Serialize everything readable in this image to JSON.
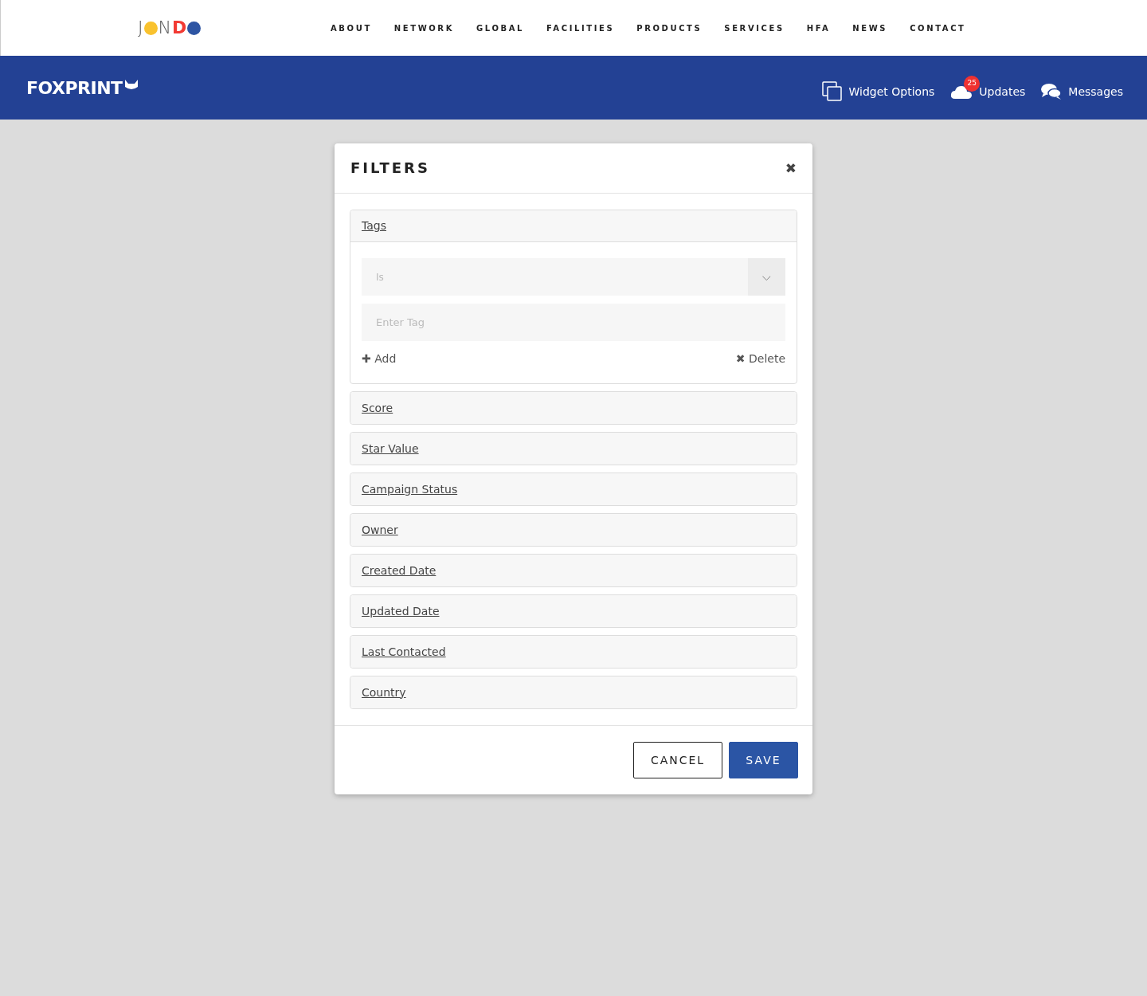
{
  "top_nav": {
    "logo": [
      {
        "kind": "letter",
        "text": "J"
      },
      {
        "kind": "dot",
        "color": "#f9c22e"
      },
      {
        "kind": "letter",
        "text": "N"
      },
      {
        "kind": "bold",
        "text": "D",
        "color": "#f23a33"
      },
      {
        "kind": "dot",
        "color": "#2e55a3"
      }
    ],
    "links": [
      "ABOUT",
      "NETWORK",
      "GLOBAL",
      "FACILITIES",
      "PRODUCTS",
      "SERVICES",
      "HFA",
      "NEWS",
      "CONTACT"
    ]
  },
  "app_bar": {
    "brand": "FOXPRINT",
    "actions": [
      {
        "kind": "widgets",
        "label": "Widget Options"
      },
      {
        "kind": "updates",
        "label": "Updates",
        "badge": "25"
      },
      {
        "kind": "messages",
        "label": "Messages"
      }
    ]
  },
  "modal": {
    "title": "FILTERS",
    "close": "✖",
    "sections": [
      {
        "label": "Tags",
        "expanded": true,
        "select": {
          "value": "Is",
          "caret": "⌵"
        },
        "input": {
          "placeholder": "Enter Tag"
        },
        "add": {
          "icon": "✚",
          "label": "Add"
        },
        "delete": {
          "icon": "✖",
          "label": "Delete"
        }
      },
      {
        "label": "Score",
        "expanded": false
      },
      {
        "label": "Star Value",
        "expanded": false
      },
      {
        "label": "Campaign Status",
        "expanded": false
      },
      {
        "label": "Owner",
        "expanded": false
      },
      {
        "label": "Created Date",
        "expanded": false
      },
      {
        "label": "Updated Date",
        "expanded": false
      },
      {
        "label": "Last Contacted",
        "expanded": false
      },
      {
        "label": "Country",
        "expanded": false
      }
    ],
    "buttons": [
      {
        "kind": "secondary",
        "label": "CANCEL"
      },
      {
        "kind": "primary",
        "label": "SAVE"
      }
    ]
  }
}
